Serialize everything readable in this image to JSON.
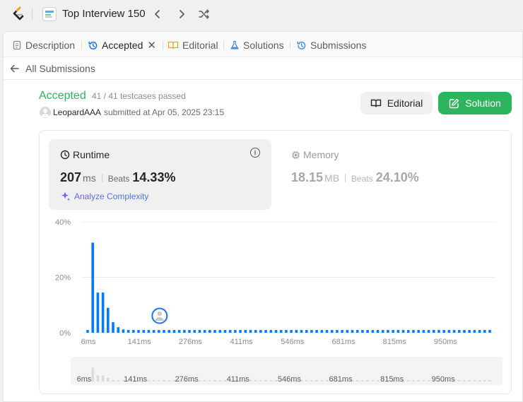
{
  "topbar": {
    "list_title": "Top Interview 150",
    "prev_icon": "chevron-left-icon",
    "next_icon": "chevron-right-icon",
    "shuffle_icon": "shuffle-icon"
  },
  "tabs": [
    {
      "label": "Description",
      "icon": "document-icon"
    },
    {
      "label": "Accepted",
      "icon": "history-icon"
    },
    {
      "label": "Editorial",
      "icon": "book-icon"
    },
    {
      "label": "Solutions",
      "icon": "flask-icon"
    },
    {
      "label": "Submissions",
      "icon": "history-icon"
    }
  ],
  "back": {
    "label": "All Submissions"
  },
  "submission": {
    "status": "Accepted",
    "testcases": "41 / 41 testcases passed",
    "user": "LeopardAAA",
    "submitted_at": "submitted at Apr 05, 2025 23:15"
  },
  "buttons": {
    "editorial": "Editorial",
    "solution": "Solution"
  },
  "runtime": {
    "title": "Runtime",
    "value": "207",
    "unit": "ms",
    "beats_label": "Beats",
    "beats_value": "14.33%",
    "analyze": "Analyze Complexity"
  },
  "memory": {
    "title": "Memory",
    "value": "18.15",
    "unit": "MB",
    "beats_label": "Beats",
    "beats_value": "24.10%"
  },
  "colors": {
    "accent_green": "#2db55d",
    "bar_blue": "#007aff"
  },
  "chart_data": {
    "type": "bar",
    "y_ticks": [
      "40%",
      "20%",
      "0%"
    ],
    "ylim": [
      0,
      40
    ],
    "x_tick_labels": [
      "6ms",
      "141ms",
      "276ms",
      "411ms",
      "546ms",
      "681ms",
      "815ms",
      "950ms"
    ],
    "values": [
      1,
      32.5,
      14.5,
      14.5,
      9,
      3.8,
      2,
      1.2,
      1,
      1,
      1,
      1,
      1,
      1,
      1,
      1,
      1,
      1,
      1,
      1,
      1,
      1,
      1,
      1,
      1,
      1,
      1,
      1,
      1,
      1,
      1,
      1,
      1,
      1,
      1,
      1,
      1,
      1,
      1,
      1,
      1,
      1,
      1,
      1,
      1,
      1,
      1,
      1,
      1,
      1,
      1,
      1,
      1,
      1,
      1,
      1,
      1,
      1,
      1,
      1,
      1,
      1,
      1,
      1,
      1,
      1,
      1,
      1,
      1,
      1,
      1,
      1,
      1,
      1,
      1,
      1,
      1,
      1,
      1,
      1
    ],
    "user_marker_index": 14,
    "grid": true
  }
}
